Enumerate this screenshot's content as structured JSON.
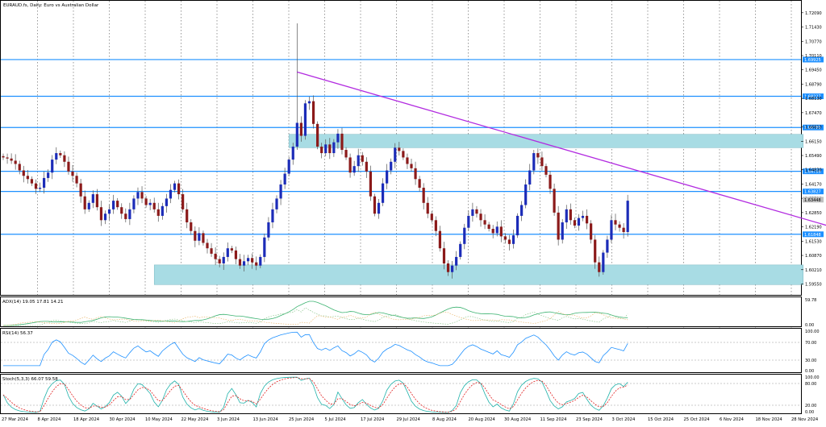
{
  "window": {
    "title": "EURAUD.fs, Daily: Euro vs Australian Dollar"
  },
  "colors": {
    "bull": "#1c2cb8",
    "bear": "#8b1a1a",
    "hline": "#1e90ff",
    "trendline": "#b22be0",
    "zone": "#a8dce4",
    "adx": "#3cb371",
    "dip": "#7fbf7f",
    "dim": "#e8b060",
    "rsi": "#1e90ff",
    "stoch_main": "#20b2aa",
    "stoch_signal": "#e02020",
    "price_tag": "#1e90ff"
  },
  "main_chart": {
    "price_ticks": [
      "1.72090",
      "1.71430",
      "1.70770",
      "1.70110",
      "1.69450",
      "1.68790",
      "1.68130",
      "1.67470",
      "1.66810",
      "1.66150",
      "1.65490",
      "1.64830",
      "1.64170",
      "1.63510",
      "1.62850",
      "1.62190",
      "1.61530",
      "1.60870",
      "1.60210",
      "1.59550"
    ],
    "price_range": [
      1.5927,
      1.7253
    ],
    "horizontal_levels": [
      {
        "price": 1.69925,
        "label": "1.69925"
      },
      {
        "price": 1.68227,
        "label": "1.68227"
      },
      {
        "price": 1.66785,
        "label": "1.66785"
      },
      {
        "price": 1.64759,
        "label": "1.64759"
      },
      {
        "price": 1.63827,
        "label": "1.63827"
      },
      {
        "price": 1.61848,
        "label": "1.61848"
      }
    ],
    "current_price": "1.63448",
    "zones": [
      {
        "name": "resistance-zone",
        "bar_from": 70,
        "bar_to": 196,
        "price_top": 1.6647,
        "price_bottom": 1.6585
      },
      {
        "name": "support-zone",
        "bar_from": 37,
        "bar_to": 196,
        "price_top": 1.6043,
        "price_bottom": 1.5952
      }
    ],
    "trendline": {
      "bar1": 72,
      "price1": 1.6935,
      "bar2": 205,
      "price2": 1.6208
    }
  },
  "candles": {
    "closes": [
      1.654,
      1.6535,
      1.6525,
      1.651,
      1.648,
      1.6455,
      1.644,
      1.642,
      1.6395,
      1.64,
      1.6445,
      1.647,
      1.653,
      1.656,
      1.655,
      1.652,
      1.6475,
      1.6455,
      1.642,
      1.636,
      1.63,
      1.633,
      1.637,
      1.631,
      1.625,
      1.628,
      1.63,
      1.634,
      1.631,
      1.628,
      1.6255,
      1.63,
      1.635,
      1.638,
      1.635,
      1.632,
      1.633,
      1.63,
      1.627,
      1.6315,
      1.635,
      1.639,
      1.642,
      1.637,
      1.63,
      1.624,
      1.62,
      1.6155,
      1.619,
      1.6145,
      1.612,
      1.6095,
      1.607,
      1.605,
      1.608,
      1.612,
      1.611,
      1.607,
      1.604,
      1.606,
      1.6075,
      1.6055,
      1.604,
      1.608,
      1.617,
      1.624,
      1.63,
      1.635,
      1.6415,
      1.6465,
      1.653,
      1.659,
      1.67,
      1.664,
      1.679,
      1.68,
      1.6695,
      1.659,
      1.656,
      1.66,
      1.656,
      1.661,
      1.665,
      1.6575,
      1.654,
      1.647,
      1.65,
      1.655,
      1.652,
      1.6475,
      1.636,
      1.628,
      1.633,
      1.642,
      1.648,
      1.652,
      1.6585,
      1.657,
      1.654,
      1.651,
      1.649,
      1.644,
      1.64,
      1.633,
      1.628,
      1.625,
      1.62,
      1.612,
      1.605,
      1.601,
      1.604,
      1.608,
      1.614,
      1.6215,
      1.627,
      1.63,
      1.628,
      1.625,
      1.623,
      1.621,
      1.619,
      1.622,
      1.6175,
      1.616,
      1.614,
      1.618,
      1.627,
      1.632,
      1.6415,
      1.648,
      1.656,
      1.654,
      1.65,
      1.646,
      1.6395,
      1.6285,
      1.616,
      1.624,
      1.63,
      1.625,
      1.6225,
      1.626,
      1.627,
      1.6235,
      1.616,
      1.6055,
      1.601,
      1.61,
      1.616,
      1.625,
      1.623,
      1.6215,
      1.6195,
      1.634
    ],
    "range_wicks": [
      [
        72,
        1.687,
        1.716
      ]
    ]
  },
  "date_labels": [
    "27 Mar 2024",
    "8 Apr 2024",
    "18 Apr 2024",
    "30 Apr 2024",
    "10 May 2024",
    "22 May 2024",
    "3 Jun 2024",
    "13 Jun 2024",
    "25 Jun 2024",
    "5 Jul 2024",
    "17 Jul 2024",
    "29 Jul 2024",
    "8 Aug 2024",
    "20 Aug 2024",
    "30 Aug 2024",
    "11 Sep 2024",
    "23 Sep 2024",
    "3 Oct 2024",
    "15 Oct 2024",
    "25 Oct 2024",
    "6 Nov 2024",
    "18 Nov 2024",
    "28 Nov 2024"
  ],
  "adx_panel": {
    "label": "ADX(14) 19.05 17.81 14.21",
    "ticks": [
      "59.78",
      "0.00"
    ]
  },
  "rsi_panel": {
    "label": "RSI(14) 56.37",
    "ticks": [
      "100.00",
      "70.00",
      "30.00",
      "0.00"
    ]
  },
  "stoch_panel": {
    "label": "Stoch(5,3,3) 66.07 59.58",
    "ticks": [
      "100.00",
      "80.00",
      "20.00",
      "0.00"
    ]
  }
}
